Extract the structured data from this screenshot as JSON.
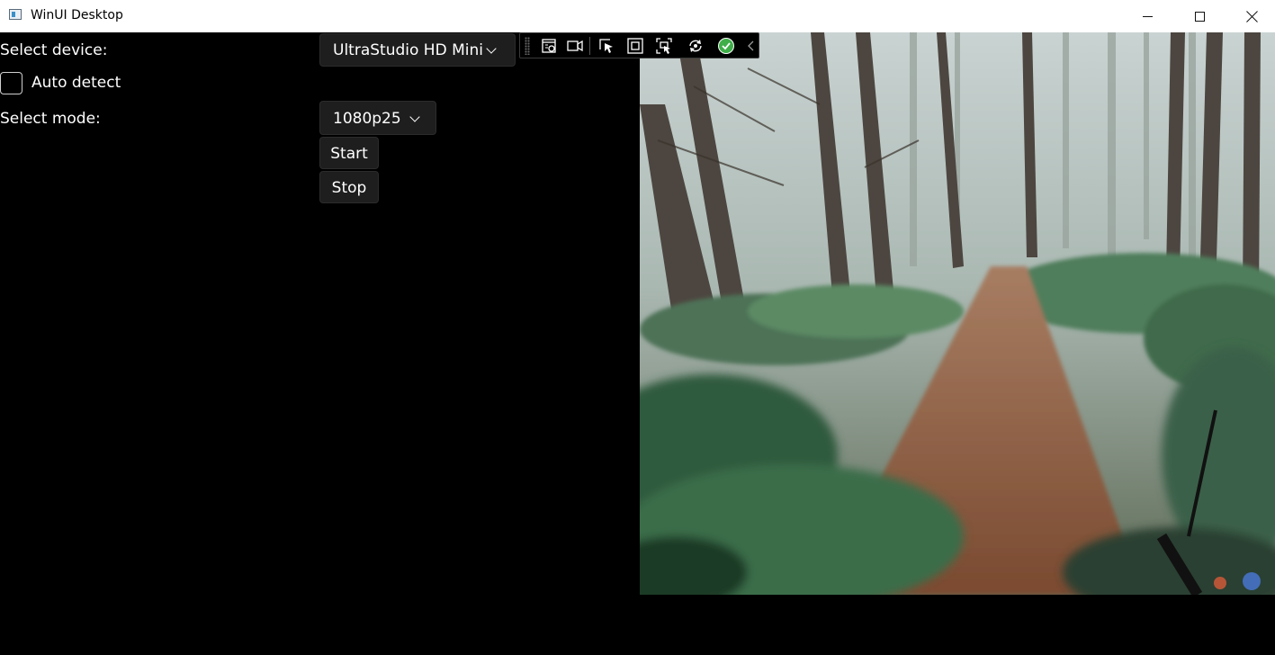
{
  "window": {
    "title": "WinUI Desktop"
  },
  "controls": {
    "device_label": "Select device:",
    "device_value": "UltraStudio HD Mini",
    "auto_detect_label": "Auto detect",
    "auto_detect_checked": false,
    "mode_label": "Select mode:",
    "mode_value": "1080p25",
    "start_label": "Start",
    "stop_label": "Stop"
  },
  "debug_toolbar": {
    "icons": [
      "go-to-live-visual-tree-icon",
      "show-in-app-toolbar-icon",
      "select-element-icon",
      "display-layout-adorners-icon",
      "track-focused-element-icon",
      "hot-reload-icon",
      "hot-reload-status-check-icon",
      "collapse-toolbar-chevron-icon"
    ],
    "accent": "#3fae49"
  },
  "video": {
    "content": "forest-trail-video-frame"
  },
  "colors": {
    "background": "#000000",
    "titlebar": "#ffffff",
    "control_bg": "#1e1e1e"
  }
}
